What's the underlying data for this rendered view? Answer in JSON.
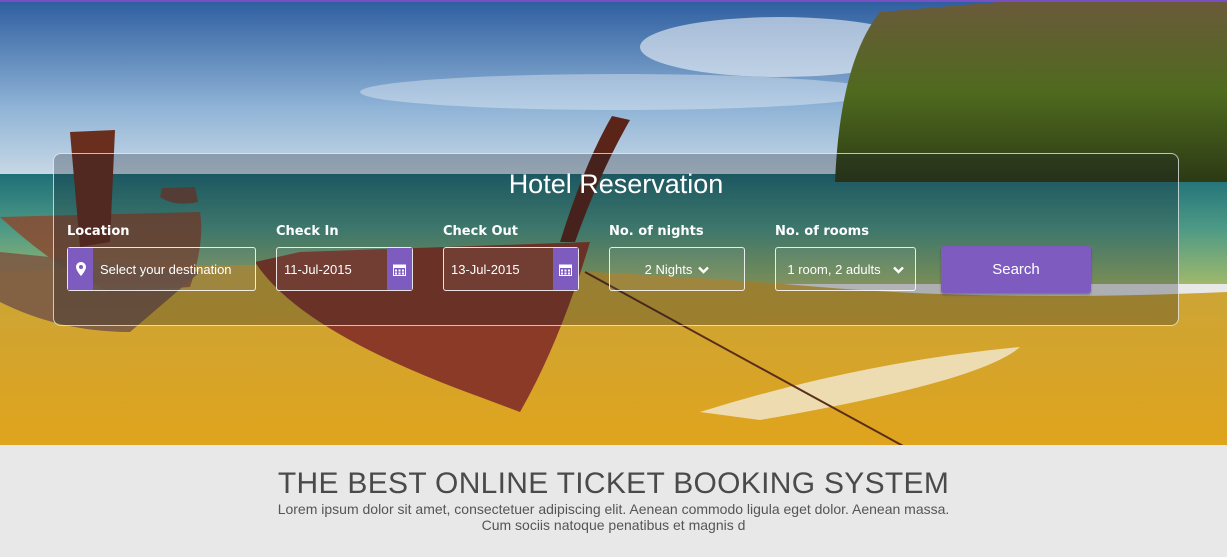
{
  "reservation": {
    "title": "Hotel Reservation",
    "location": {
      "label": "Location",
      "placeholder": "Select your destination"
    },
    "check_in": {
      "label": "Check In",
      "value": "11-Jul-2015"
    },
    "check_out": {
      "label": "Check Out",
      "value": "13-Jul-2015"
    },
    "nights": {
      "label": "No. of nights",
      "value": "2 Nights"
    },
    "rooms": {
      "label": "No. of rooms",
      "value": "1 room, 2 adults"
    },
    "search_label": "Search"
  },
  "promo": {
    "headline": "THE BEST ONLINE TICKET BOOKING SYSTEM",
    "line1": "Lorem ipsum dolor sit amet, consectetuer adipiscing elit. Aenean commodo ligula eget dolor. Aenean massa.",
    "line2": "Cum sociis natoque penatibus et magnis d"
  },
  "colors": {
    "accent": "#7e5bbf",
    "top_border": "#7a4fc4"
  },
  "icons": {
    "location": "map-marker-icon",
    "calendar": "calendar-icon",
    "dropdown": "chevron-down-icon"
  }
}
